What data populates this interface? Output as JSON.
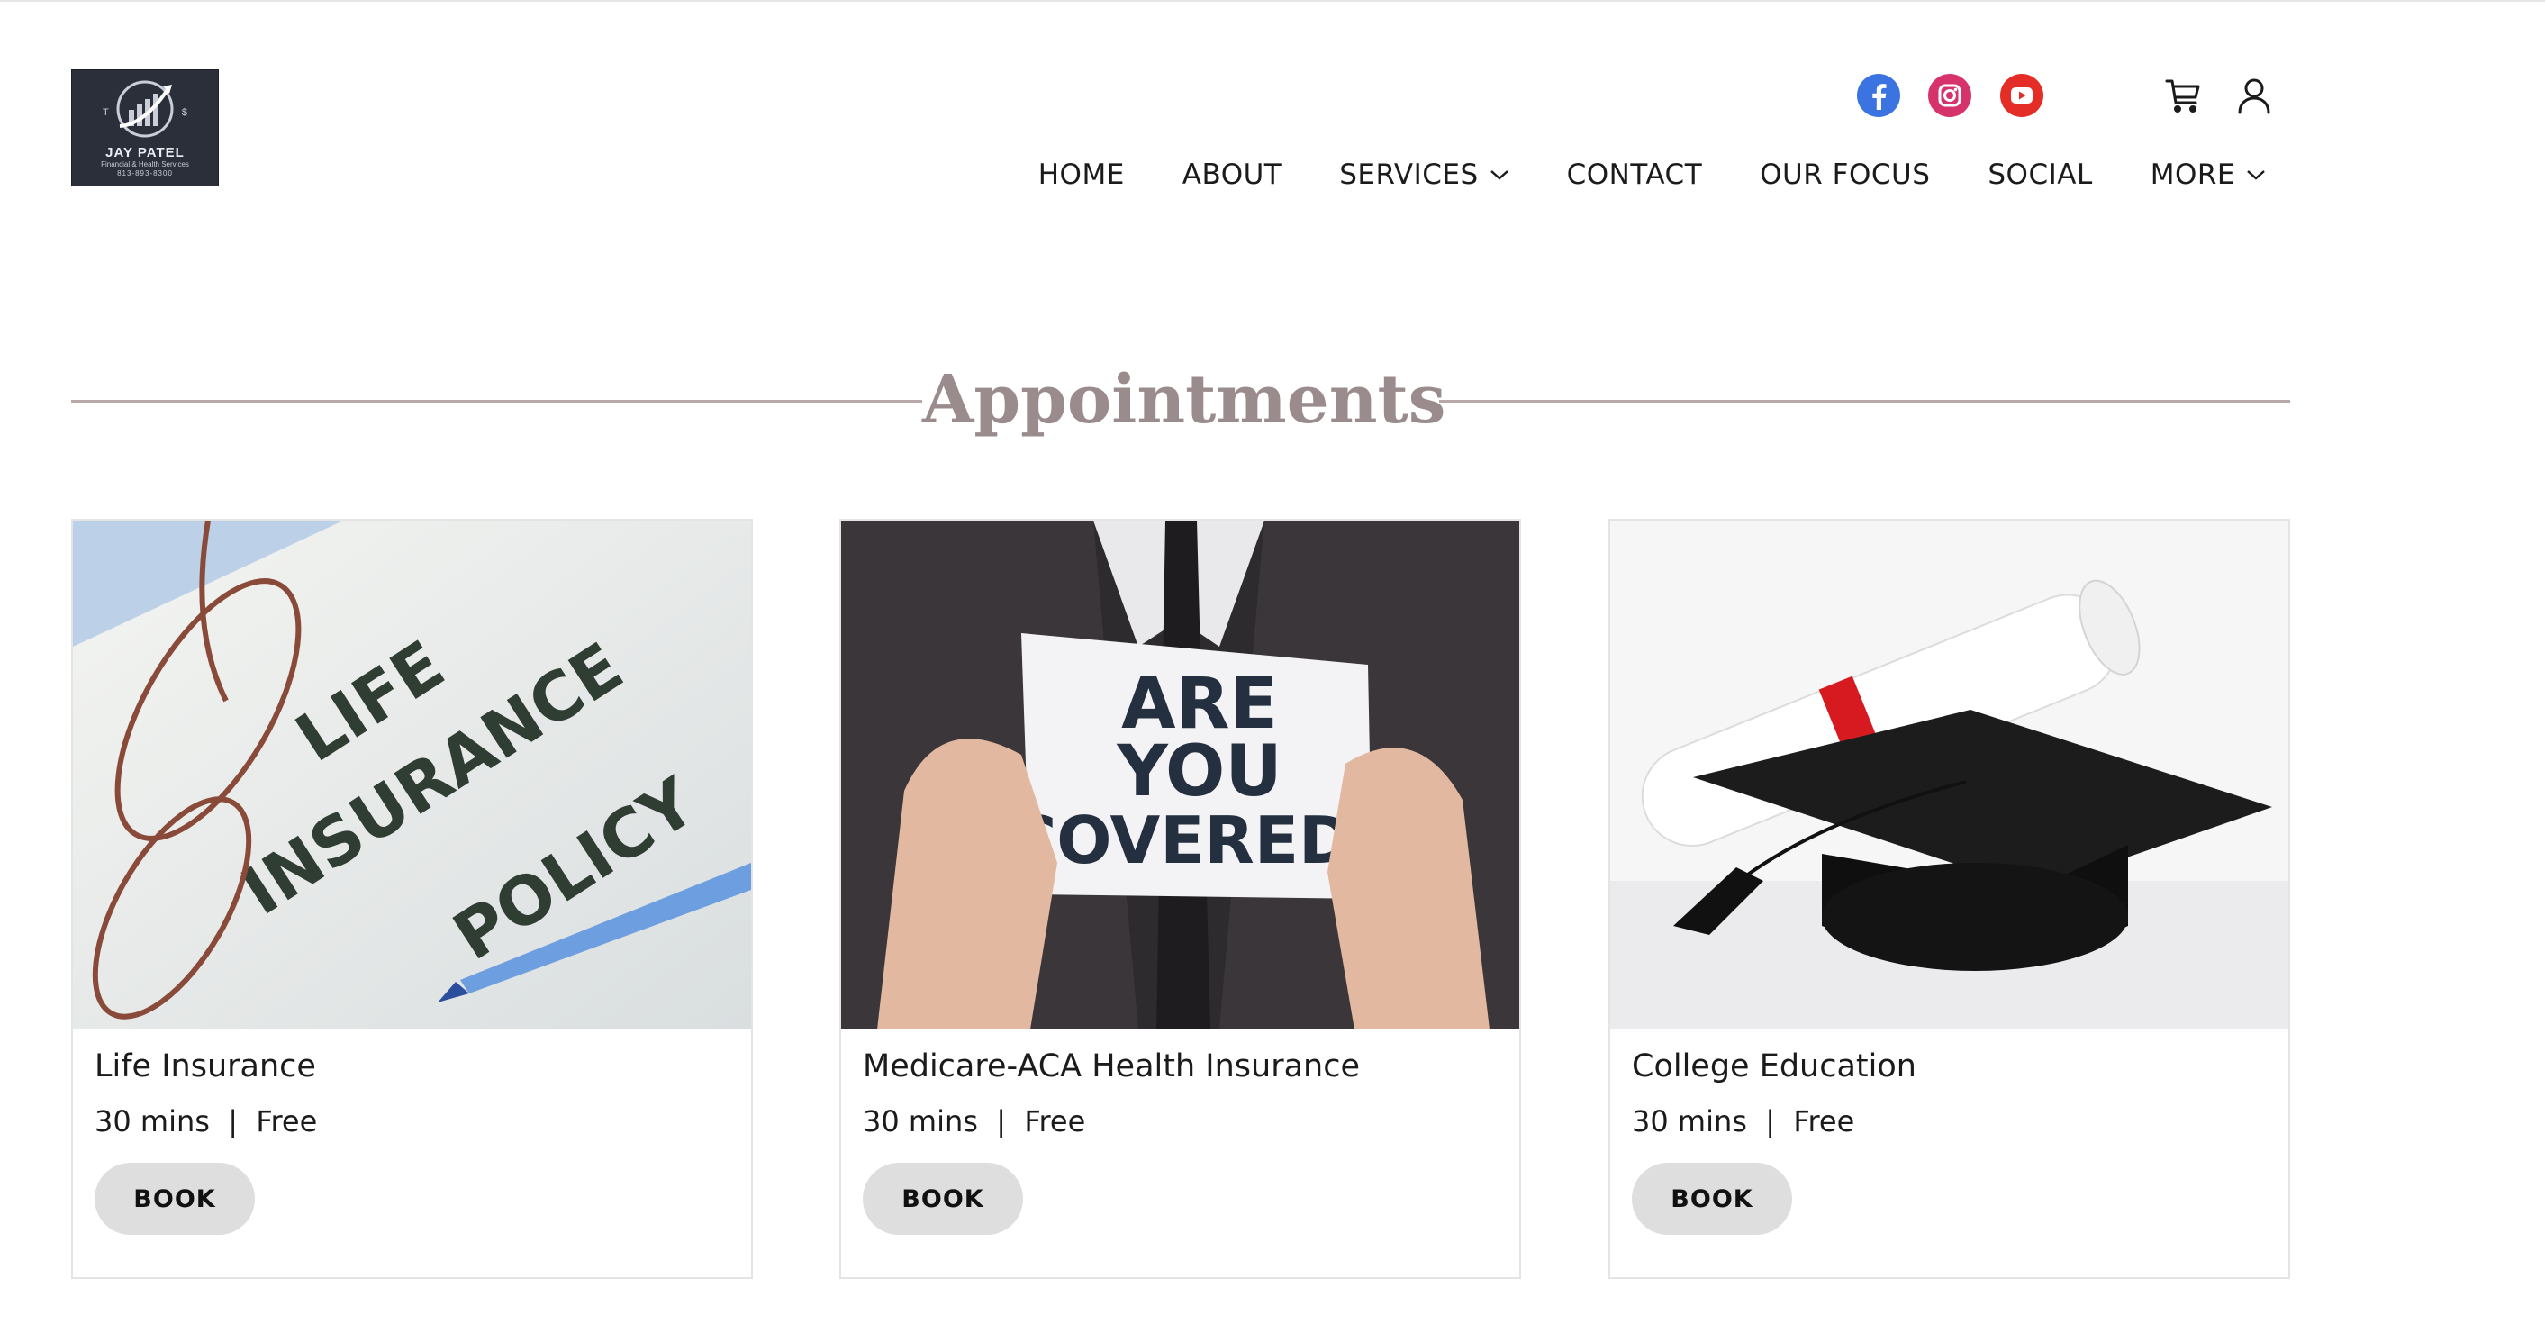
{
  "brand": {
    "logo_name": "JAY PATEL",
    "logo_subtitle": "Financial & Health Services",
    "logo_phone": "813-893-8300",
    "logo_left_letter": "T",
    "logo_right_letter": "$"
  },
  "social": [
    {
      "name": "facebook-icon",
      "color": "#3b74e0"
    },
    {
      "name": "instagram-icon",
      "color": "#d6336c"
    },
    {
      "name": "youtube-icon",
      "color": "#e52d27"
    }
  ],
  "utility": [
    {
      "name": "cart-icon"
    },
    {
      "name": "account-icon"
    }
  ],
  "nav": {
    "items": [
      {
        "label": "HOME",
        "dropdown": false
      },
      {
        "label": "ABOUT",
        "dropdown": false
      },
      {
        "label": "SERVICES",
        "dropdown": true
      },
      {
        "label": "CONTACT",
        "dropdown": false
      },
      {
        "label": "OUR FOCUS",
        "dropdown": false
      },
      {
        "label": "SOCIAL",
        "dropdown": false
      },
      {
        "label": "MORE",
        "dropdown": true
      }
    ]
  },
  "section": {
    "title": "Appointments"
  },
  "cards": [
    {
      "title": "Life Insurance",
      "meta": "30 mins  |  Free",
      "button": "BOOK",
      "image_text": [
        "LIFE",
        "INSURANCE",
        "POLICY"
      ]
    },
    {
      "title": "Medicare-ACA Health Insurance",
      "meta": "30 mins  |  Free",
      "button": "BOOK",
      "image_text": [
        "ARE",
        "YOU",
        "COVERED?"
      ]
    },
    {
      "title": "College Education",
      "meta": "30 mins  |  Free",
      "button": "BOOK",
      "image_text": []
    }
  ],
  "colors": {
    "accent_heading": "#9a8c8c",
    "rule": "#b9a8a8",
    "button_bg": "#dedede"
  }
}
